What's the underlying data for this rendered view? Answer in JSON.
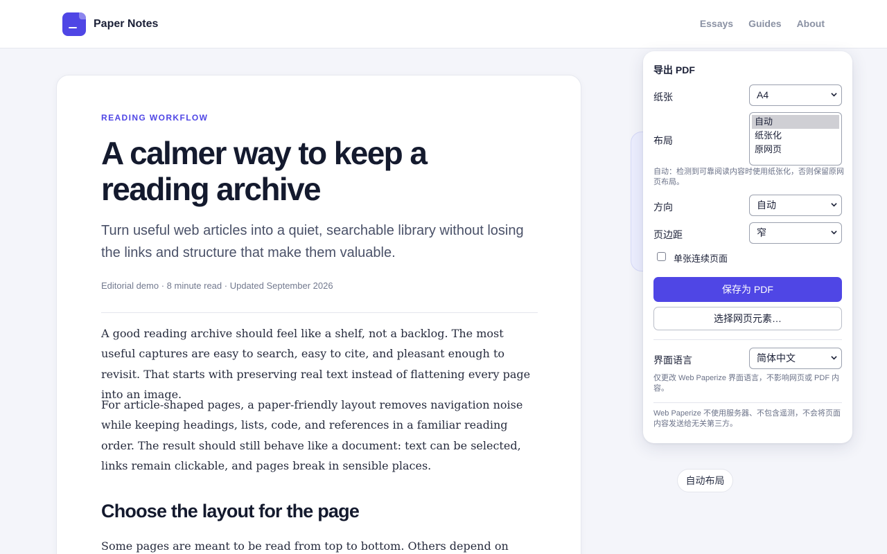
{
  "header": {
    "brand": "Paper Notes",
    "nav": [
      "Essays",
      "Guides",
      "About"
    ]
  },
  "article": {
    "kicker": "READING WORKFLOW",
    "title": "A calmer way to keep a reading archive",
    "dek": "Turn useful web articles into a quiet, searchable library without losing the links and structure that make them valuable.",
    "meta": "Editorial demo · 8 minute read · Updated September 2026",
    "paragraphs": [
      "A good reading archive should feel like a shelf, not a backlog. The most useful captures are easy to search, easy to cite, and pleasant enough to revisit. That starts with preserving real text instead of flattening every page into an image.",
      "For article-shaped pages, a paper-friendly layout removes navigation noise while keeping headings, lists, code, and references in a familiar reading order. The result should still behave like a document: text can be selected, links remain clickable, and pages break in sensible places."
    ],
    "heading2": "Choose the layout for the page",
    "paragraph3": "Some pages are meant to be read from top to bottom. Others depend on cards,"
  },
  "panel": {
    "title": "导出 PDF",
    "paper_label": "纸张",
    "paper_value": "A4",
    "layout_label": "布局",
    "layout_options": [
      "自动",
      "纸张化",
      "原网页"
    ],
    "layout_selected": "自动",
    "layout_hint": "自动：检测到可靠阅读内容时使用纸张化，否则保留原网页布局。",
    "orientation_label": "方向",
    "orientation_value": "自动",
    "margin_label": "页边距",
    "margin_value": "窄",
    "single_page_label": "单张连续页面",
    "single_page_checked": false,
    "save_button": "保存为 PDF",
    "select_element_button": "选择网页元素…",
    "language_label": "界面语言",
    "language_value": "简体中文",
    "language_hint": "仅更改 Web Paperize 界面语言，不影响网页或 PDF 内容。",
    "privacy_note": "Web Paperize 不使用服务器、不包含遥测，不会将页面内容发送给无关第三方。",
    "accent": "#4f46e5"
  },
  "badge": {
    "label": "自动布局"
  }
}
